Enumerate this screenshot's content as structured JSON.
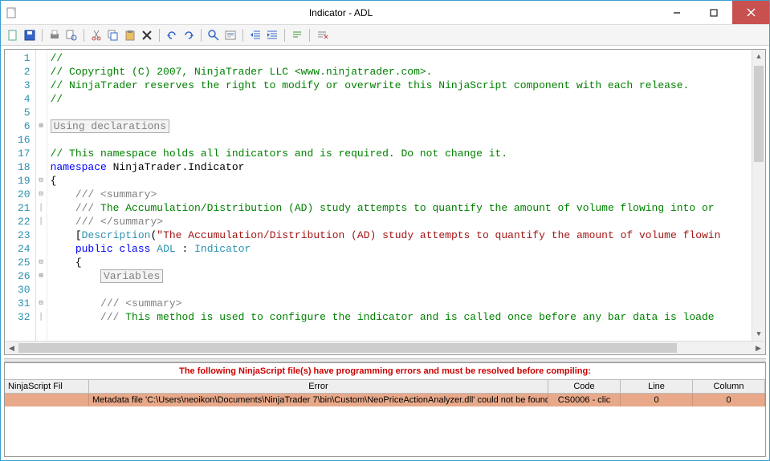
{
  "window": {
    "title": "Indicator - ADL"
  },
  "toolbar_icons": [
    "new",
    "save",
    "print",
    "print-preview",
    "pixel-ruler",
    "cut",
    "copy",
    "paste",
    "delete",
    "undo",
    "redo",
    "find",
    "goto",
    "outdent",
    "indent",
    "comment",
    "uncomment"
  ],
  "editor": {
    "lines": [
      {
        "n": 1,
        "fold": "",
        "html": "<span class='c-green'>//</span>"
      },
      {
        "n": 2,
        "fold": "",
        "html": "<span class='c-green'>// Copyright (C) 2007, NinjaTrader LLC &lt;www.ninjatrader.com&gt;.</span>"
      },
      {
        "n": 3,
        "fold": "",
        "html": "<span class='c-green'>// NinjaTrader reserves the right to modify or overwrite this NinjaScript component with each release.</span>"
      },
      {
        "n": 4,
        "fold": "",
        "html": "<span class='c-green'>//</span>"
      },
      {
        "n": 5,
        "fold": "",
        "html": ""
      },
      {
        "n": 6,
        "fold": "⊞",
        "html": "<span class='region'>Using declarations</span>"
      },
      {
        "n": 16,
        "fold": "",
        "html": ""
      },
      {
        "n": 17,
        "fold": "",
        "html": "<span class='c-green'>// This namespace holds all indicators and is required. Do not change it.</span>"
      },
      {
        "n": 18,
        "fold": "",
        "html": "<span class='c-blue'>namespace</span><span class='c-black'> NinjaTrader.Indicator</span>"
      },
      {
        "n": 19,
        "fold": "⊟",
        "html": "<span class='c-black'>{</span>"
      },
      {
        "n": 20,
        "fold": "⊟",
        "html": "    <span class='c-gray'>/// &lt;summary&gt;</span>"
      },
      {
        "n": 21,
        "fold": "│",
        "html": "    <span class='c-gray'>///</span><span class='c-green'> The Accumulation/Distribution (AD) study attempts to quantify the amount of volume flowing into or </span>"
      },
      {
        "n": 22,
        "fold": "│",
        "html": "    <span class='c-gray'>/// &lt;/summary&gt;</span>"
      },
      {
        "n": 23,
        "fold": "",
        "html": "    <span class='c-black'>[</span><span class='c-type'>Description</span><span class='c-black'>(</span><span class='c-str'>\"The Accumulation/Distribution (AD) study attempts to quantify the amount of volume flowin</span>"
      },
      {
        "n": 24,
        "fold": "",
        "html": "    <span class='c-blue'>public</span> <span class='c-blue'>class</span> <span class='c-type'>ADL</span><span class='c-black'> : </span><span class='c-type'>Indicator</span>"
      },
      {
        "n": 25,
        "fold": "⊟",
        "html": "    <span class='c-black'>{</span>"
      },
      {
        "n": 26,
        "fold": "⊞",
        "html": "        <span class='region'>Variables</span>"
      },
      {
        "n": 30,
        "fold": "",
        "html": ""
      },
      {
        "n": 31,
        "fold": "⊟",
        "html": "        <span class='c-gray'>/// &lt;summary&gt;</span>"
      },
      {
        "n": 32,
        "fold": "│",
        "html": "        <span class='c-gray'>///</span><span class='c-green'> This method is used to configure the indicator and is called once before any bar data is loade</span>"
      }
    ]
  },
  "errors": {
    "banner": "The following NinjaScript file(s) have programming errors and must be resolved before compiling:",
    "headers": {
      "file": "NinjaScript Fil",
      "error": "Error",
      "code": "Code",
      "line": "Line",
      "column": "Column"
    },
    "rows": [
      {
        "file": "",
        "error": "Metadata file 'C:\\Users\\neoikon\\Documents\\NinjaTrader 7\\bin\\Custom\\NeoPriceActionAnalyzer.dll' could not be found",
        "code": "CS0006 - clic",
        "line": "0",
        "column": "0"
      }
    ]
  }
}
